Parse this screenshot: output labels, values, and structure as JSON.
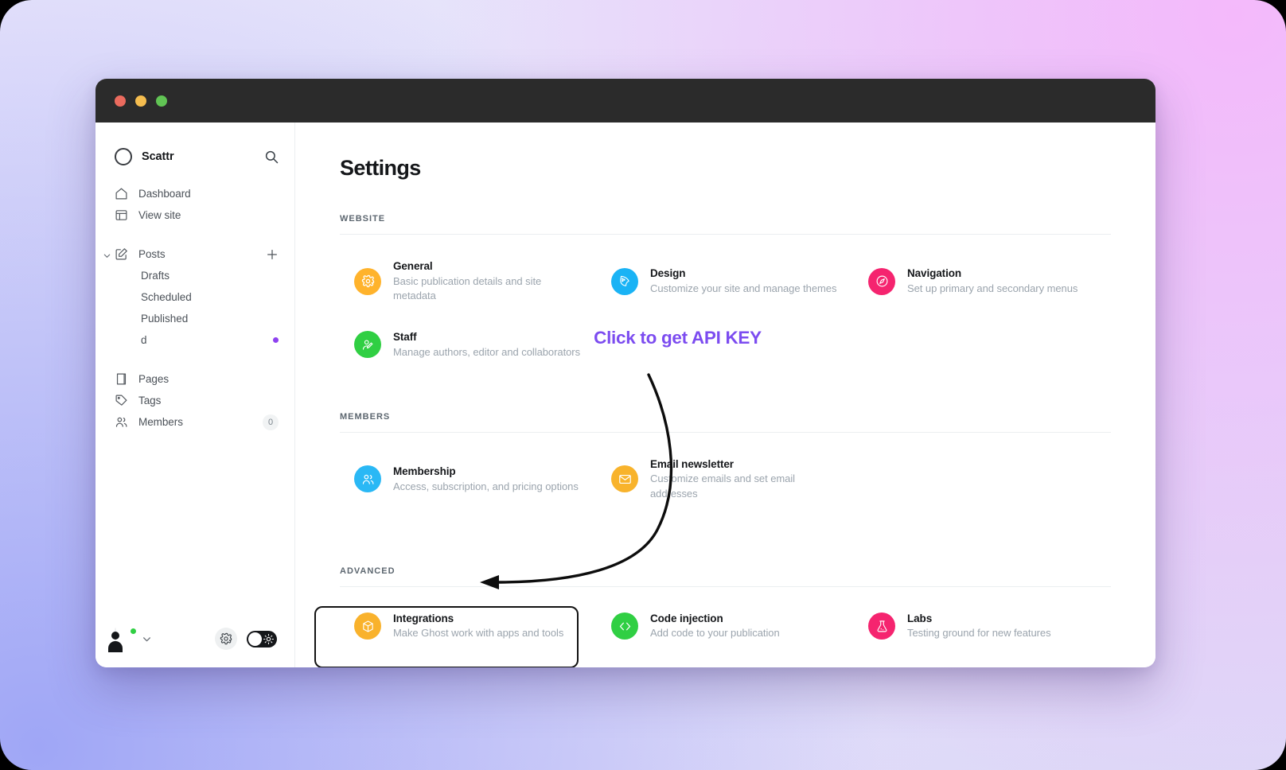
{
  "window": {
    "traffic_lights": [
      "close",
      "minimize",
      "maximize"
    ]
  },
  "sidebar": {
    "brand": {
      "name": "Scattr",
      "logo": "circle-logo",
      "search_icon": "search-icon"
    },
    "nav": [
      {
        "label": "Dashboard",
        "icon": "home-icon"
      },
      {
        "label": "View site",
        "icon": "layout-icon"
      }
    ],
    "posts": {
      "label": "Posts",
      "icon": "pencil-square-icon",
      "caret": "chevron-down-icon",
      "add": "plus-icon",
      "children": [
        {
          "label": "Drafts",
          "badge": ""
        },
        {
          "label": "Scheduled",
          "badge": ""
        },
        {
          "label": "Published",
          "badge": ""
        },
        {
          "label": "d",
          "badge": "dot"
        }
      ]
    },
    "nav2": [
      {
        "label": "Pages",
        "icon": "book-icon",
        "badge": ""
      },
      {
        "label": "Tags",
        "icon": "tag-icon",
        "badge": ""
      },
      {
        "label": "Members",
        "icon": "people-icon",
        "badge": "0"
      }
    ],
    "footer": {
      "avatar": "user-avatar",
      "status": "online",
      "caret": "chevron-down-icon",
      "gear": "gear-icon",
      "theme_toggle": {
        "state": "light",
        "icon": "sun-icon"
      }
    }
  },
  "main": {
    "title": "Settings",
    "sections": [
      {
        "label": "WEBSITE",
        "cards": [
          {
            "title": "General",
            "desc": "Basic publication details and site metadata",
            "icon": "gear-icon",
            "color": "#ffb32c"
          },
          {
            "title": "Design",
            "desc": "Customize your site and manage themes",
            "icon": "palette-icon",
            "color": "#1ab3f5"
          },
          {
            "title": "Navigation",
            "desc": "Set up primary and secondary menus",
            "icon": "compass-icon",
            "color": "#f5246f"
          },
          {
            "title": "Staff",
            "desc": "Manage authors, editor and collaborators",
            "icon": "user-edit-icon",
            "color": "#30cf43"
          }
        ]
      },
      {
        "label": "MEMBERS",
        "cards": [
          {
            "title": "Membership",
            "desc": "Access, subscription, and pricing options",
            "icon": "people-icon",
            "color": "#2ab8f5"
          },
          {
            "title": "Email newsletter",
            "desc": "Customize emails and set email addresses",
            "icon": "envelope-icon",
            "color": "#f8b32c"
          }
        ]
      },
      {
        "label": "ADVANCED",
        "cards": [
          {
            "title": "Integrations",
            "desc": "Make Ghost work with apps and tools",
            "icon": "cube-icon",
            "color": "#f9b22c"
          },
          {
            "title": "Code injection",
            "desc": "Add code to your publication",
            "icon": "code-icon",
            "color": "#30cf43"
          },
          {
            "title": "Labs",
            "desc": "Testing ground for new features",
            "icon": "flask-icon",
            "color": "#f5246f"
          }
        ]
      }
    ]
  },
  "annotation": {
    "text": "Click to get API KEY",
    "color": "#7c4cf0",
    "arrow": "curved-arrow-pointing-to-integrations",
    "highlight_target": "Integrations"
  }
}
